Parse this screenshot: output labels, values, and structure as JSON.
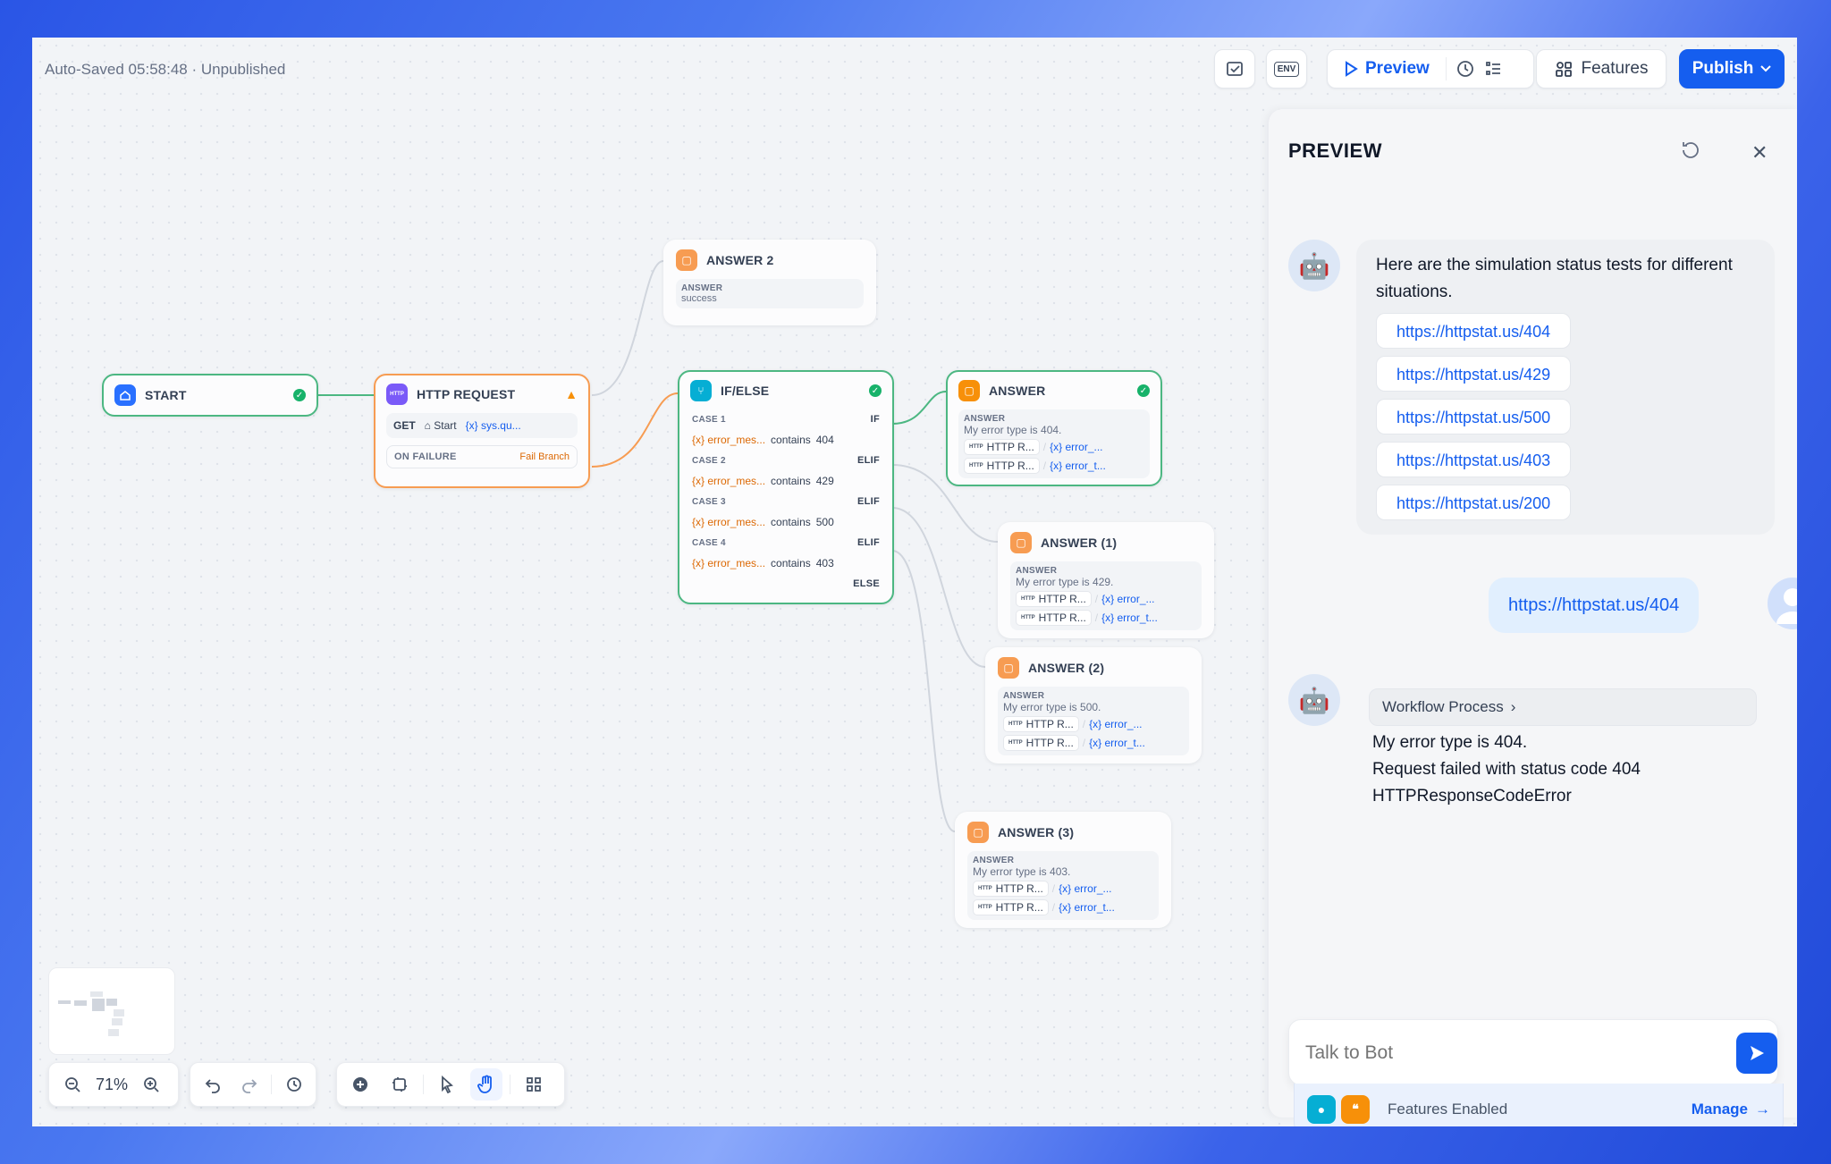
{
  "header": {
    "autosave": "Auto-Saved 05:58:48 · Unpublished",
    "env_label": "ENV",
    "preview_label": "Preview",
    "features_label": "Features",
    "publish_label": "Publish"
  },
  "nodes": {
    "start": {
      "title": "START"
    },
    "http": {
      "title": "HTTP REQUEST",
      "method": "GET",
      "var_source": "Start",
      "var_name": "sys.qu...",
      "failure_label": "ON FAILURE",
      "failure_value": "Fail Branch"
    },
    "answer2": {
      "title": "ANSWER 2",
      "label": "ANSWER",
      "text": "success"
    },
    "ifelse": {
      "title": "IF/ELSE",
      "cases": [
        {
          "label": "CASE 1",
          "keyword": "IF",
          "var": "error_mes...",
          "op": "contains",
          "value": "404"
        },
        {
          "label": "CASE 2",
          "keyword": "ELIF",
          "var": "error_mes...",
          "op": "contains",
          "value": "429"
        },
        {
          "label": "CASE 3",
          "keyword": "ELIF",
          "var": "error_mes...",
          "op": "contains",
          "value": "500"
        },
        {
          "label": "CASE 4",
          "keyword": "ELIF",
          "var": "error_mes...",
          "op": "contains",
          "value": "403"
        }
      ],
      "else_label": "ELSE"
    },
    "answers": [
      {
        "title": "ANSWER",
        "label": "ANSWER",
        "text": "My error type is 404.",
        "chip1": "HTTP R...",
        "var1": "error_...",
        "chip2": "HTTP R...",
        "var2": "error_t..."
      },
      {
        "title": "ANSWER (1)",
        "label": "ANSWER",
        "text": "My error type is 429.",
        "chip1": "HTTP R...",
        "var1": "error_...",
        "chip2": "HTTP R...",
        "var2": "error_t..."
      },
      {
        "title": "ANSWER (2)",
        "label": "ANSWER",
        "text": "My error type is 500.",
        "chip1": "HTTP R...",
        "var1": "error_...",
        "chip2": "HTTP R...",
        "var2": "error_t..."
      },
      {
        "title": "ANSWER (3)",
        "label": "ANSWER",
        "text": "My error type is 403.",
        "chip1": "HTTP R...",
        "var1": "error_...",
        "chip2": "HTTP R...",
        "var2": "error_t..."
      }
    ]
  },
  "toolbar": {
    "zoom": "71%"
  },
  "preview": {
    "title": "PREVIEW",
    "bot_intro": "Here are the simulation status tests for different situations.",
    "links": [
      "https://httpstat.us/404",
      "https://httpstat.us/429",
      "https://httpstat.us/500",
      "https://httpstat.us/403",
      "https://httpstat.us/200"
    ],
    "user_message": "https://httpstat.us/404",
    "workflow_label": "Workflow Process",
    "bot_reply": [
      "My error type is 404.",
      "Request failed with status code 404",
      "HTTPResponseCodeError"
    ],
    "input_placeholder": "Talk to Bot",
    "features_enabled": "Features Enabled",
    "manage_label": "Manage"
  },
  "colors": {
    "accent": "#155eef",
    "success": "#17b26a",
    "warning": "#f79009"
  }
}
